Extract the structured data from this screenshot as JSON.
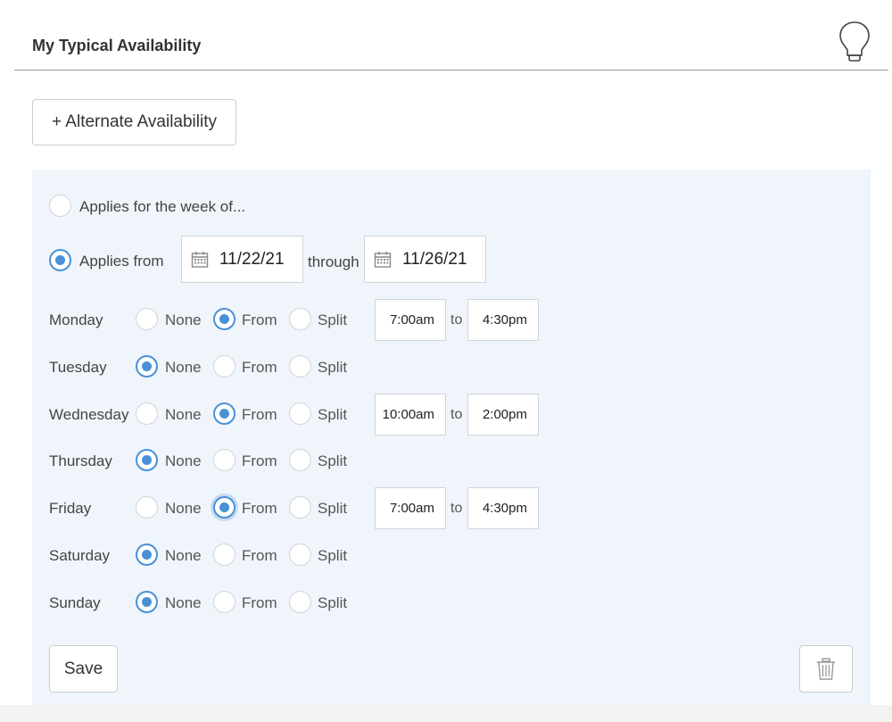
{
  "header": {
    "title": "My Typical Availability"
  },
  "alt_button": {
    "label": "+ Alternate Availability"
  },
  "applies_week": {
    "label": "Applies for the week of...",
    "selected": false
  },
  "applies_from": {
    "label": "Applies from",
    "selected": true,
    "start": "11/22/21",
    "through_label": "through",
    "end": "11/26/21"
  },
  "option_labels": {
    "none": "None",
    "from": "From",
    "split": "Split"
  },
  "to_label": "to",
  "days": [
    {
      "name": "Monday",
      "mode": "from",
      "start": "7:00am",
      "end": "4:30pm"
    },
    {
      "name": "Tuesday",
      "mode": "none"
    },
    {
      "name": "Wednesday",
      "mode": "from",
      "start": "10:00am",
      "end": "2:00pm"
    },
    {
      "name": "Thursday",
      "mode": "none"
    },
    {
      "name": "Friday",
      "mode": "from",
      "start": "7:00am",
      "end": "4:30pm"
    },
    {
      "name": "Saturday",
      "mode": "none"
    },
    {
      "name": "Sunday",
      "mode": "none"
    }
  ],
  "save_button": {
    "label": "Save"
  },
  "colors": {
    "accent": "#4a90d6",
    "panel_bg": "#eff5fb"
  }
}
